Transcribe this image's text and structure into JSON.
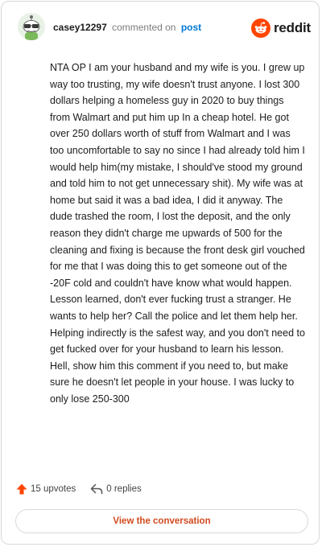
{
  "header": {
    "username": "casey12297",
    "action": "commented on",
    "link": "post",
    "brand": "reddit"
  },
  "comment": {
    "text": "NTA OP I am your husband and my wife is you. I grew up way too trusting, my wife doesn't trust anyone. I lost 300 dollars helping a homeless guy in 2020 to buy things from Walmart and put him up In a cheap hotel. He got over 250 dollars worth of stuff from Walmart and I was too uncomfortable to say no since I had already told him I would help him(my mistake, I should've stood my ground and told him to not get unnecessary shit). My wife was at home but said it was a bad idea, I did it anyway. The dude trashed the room, I lost the deposit, and the only reason they didn't charge me upwards of 500 for the cleaning and fixing is because the front desk girl vouched for me that I was doing this to get someone out of the -20F cold and couldn't have know what would happen. Lesson learned, don't ever fucking trust a stranger. He wants to help her? Call the police and let them help her. Helping indirectly is the safest way, and you don't need to get fucked over for your husband to learn his lesson. Hell, show him this comment if you need to, but make sure he doesn't let people in your house. I was lucky to only lose 250-300"
  },
  "footer": {
    "upvotes": "15 upvotes",
    "replies": "0 replies"
  },
  "cta": {
    "label": "View the conversation"
  },
  "colors": {
    "brand": "#ff4500",
    "link": "#0079d3",
    "cta": "#d14a1e"
  },
  "icons": {
    "avatar": "snoo-avatar-icon",
    "logo": "reddit-logo-icon",
    "upvote": "upvote-arrow-icon",
    "reply": "reply-arrow-icon"
  }
}
